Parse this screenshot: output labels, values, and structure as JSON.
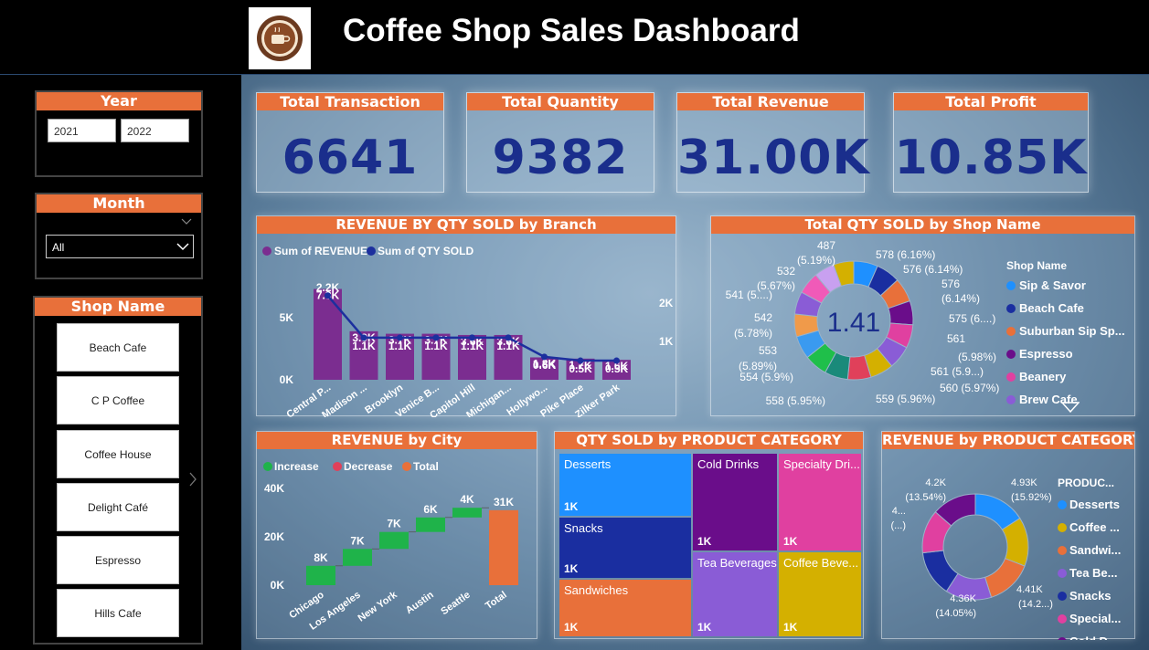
{
  "header": {
    "title": "Coffee Shop Sales Dashboard",
    "colors": {
      "accent": "#e8703a",
      "kpi_value": "#1a2e8c"
    }
  },
  "slicers": {
    "year": {
      "title": "Year",
      "options": [
        "2021",
        "2022"
      ]
    },
    "month": {
      "title": "Month",
      "selected": "All"
    },
    "shop": {
      "title": "Shop Name",
      "items": [
        "Beach Cafe",
        "C P Coffee",
        "Coffee House",
        "Delight Café",
        "Espresso",
        "Hills Cafe"
      ]
    }
  },
  "kpis": [
    {
      "label": "Total Transaction",
      "value": "6641"
    },
    {
      "label": "Total Quantity",
      "value": "9382"
    },
    {
      "label": "Total Revenue",
      "value": "31.00K"
    },
    {
      "label": "Total Profit",
      "value": "10.85K"
    }
  ],
  "chart_data": [
    {
      "type": "bar",
      "title": "REVENUE BY QTY SOLD by Branch",
      "categories": [
        "Central P...",
        "Madison ...",
        "Brooklyn",
        "Venice B...",
        "Capitol Hill",
        "Michigan...",
        "Hollywo...",
        "Pike Place",
        "Zilker Park"
      ],
      "series": [
        {
          "name": "Sum of REVENUE",
          "values": [
            7300,
            3900,
            3700,
            3700,
            3600,
            3600,
            1800,
            1700,
            1600
          ],
          "labels": [
            "7.3K",
            "3.9K",
            "3.7K",
            "3.7K",
            "3.6K",
            "3.6K",
            "1.8K",
            "1.7K",
            "1.6K"
          ],
          "color": "#7b2d90"
        },
        {
          "name": "Sum of QTY SOLD",
          "type": "line",
          "values": [
            2200,
            1100,
            1100,
            1100,
            1100,
            1100,
            600,
            500,
            500
          ],
          "labels": [
            "2.2K",
            "1.1K",
            "1.1K",
            "1.1K",
            "1.1K",
            "1.1K",
            "0.6K",
            "0.5K",
            "0.5K"
          ],
          "color": "#1c2f9e"
        }
      ],
      "y_ticks": [
        "5K",
        "0K"
      ],
      "y2_ticks": [
        "2K",
        "1K"
      ],
      "ylim": [
        0,
        8000
      ],
      "y2lim": [
        0,
        2600
      ]
    },
    {
      "type": "pie",
      "title": "Total QTY SOLD by Shop Name",
      "center_label": "1.41",
      "legend_title": "Shop Name",
      "legend": [
        {
          "name": "Sip & Savor",
          "color": "#1e90ff"
        },
        {
          "name": "Beach Cafe",
          "color": "#1a2ea0"
        },
        {
          "name": "Suburban Sip Sp...",
          "color": "#e8703a"
        },
        {
          "name": "Espresso",
          "color": "#6a0d8a"
        },
        {
          "name": "Beanery",
          "color": "#e040a0"
        },
        {
          "name": "Brew Cafe",
          "color": "#8a5cd6"
        }
      ],
      "slices": [
        {
          "value": 578,
          "color": "#1e90ff"
        },
        {
          "value": 576,
          "color": "#1a2ea0"
        },
        {
          "value": 576,
          "color": "#e8703a"
        },
        {
          "value": 575,
          "color": "#6a0d8a"
        },
        {
          "value": 561,
          "color": "#e040a0"
        },
        {
          "value": 561,
          "color": "#8a5cd6"
        },
        {
          "value": 560,
          "color": "#d4b000"
        },
        {
          "value": 559,
          "color": "#e0405a"
        },
        {
          "value": 558,
          "color": "#1a8a7a"
        },
        {
          "value": 554,
          "color": "#1fbf4a"
        },
        {
          "value": 553,
          "color": "#3a9af0"
        },
        {
          "value": 542,
          "color": "#f09a4a"
        },
        {
          "value": 541,
          "color": "#8a5cd6"
        },
        {
          "value": 532,
          "color": "#f05ab8"
        },
        {
          "value": 487,
          "color": "#c8a0f0"
        },
        {
          "value": 487,
          "color": "#d4b000"
        }
      ],
      "labels": [
        "578 (6.16%)",
        "576 (6.14%)",
        "576",
        "(6.14%)",
        "575 (6....)",
        "561",
        "(5.98%)",
        "561 (5.9...)",
        "560 (5.97%)",
        "559 (5.96%)",
        "558 (5.95%)",
        "554 (5.9%)",
        "553",
        "(5.89%)",
        "542",
        "(5.78%)",
        "541 (5....)",
        "532",
        "(5.67%)",
        "487",
        "(5.19%)"
      ]
    },
    {
      "type": "bar",
      "subtype": "waterfall",
      "title": "REVENUE by City",
      "legend": [
        {
          "name": "Increase",
          "color": "#1fb34a"
        },
        {
          "name": "Decrease",
          "color": "#e0405a"
        },
        {
          "name": "Total",
          "color": "#e8703a"
        }
      ],
      "categories": [
        "Chicago",
        "Los Angeles",
        "New York",
        "Austin",
        "Seattle",
        "Total"
      ],
      "values": [
        8000,
        7000,
        7000,
        6000,
        4000,
        31000
      ],
      "labels": [
        "8K",
        "7K",
        "7K",
        "6K",
        "4K",
        "31K"
      ],
      "y_ticks": [
        "40K",
        "20K",
        "0K"
      ],
      "ylim": [
        0,
        40000
      ]
    },
    {
      "type": "table",
      "subtype": "treemap",
      "title": "QTY SOLD by PRODUCT CATEGORY",
      "cells": [
        {
          "name": "Desserts",
          "value": "1K",
          "color": "#1e90ff"
        },
        {
          "name": "Snacks",
          "value": "1K",
          "color": "#1a2ea0"
        },
        {
          "name": "Sandwiches",
          "value": "1K",
          "color": "#e8703a"
        },
        {
          "name": "Cold Drinks",
          "value": "1K",
          "color": "#6a0d8a"
        },
        {
          "name": "Tea Beverages",
          "value": "1K",
          "color": "#8a5cd6"
        },
        {
          "name": "Specialty Dri...",
          "value": "1K",
          "color": "#e040a0"
        },
        {
          "name": "Coffee Beve...",
          "value": "1K",
          "color": "#d4b000"
        }
      ]
    },
    {
      "type": "pie",
      "title": "REVENUE by PRODUCT CATEGORY",
      "legend_title": "PRODUC...",
      "legend": [
        {
          "name": "Desserts",
          "color": "#1e90ff"
        },
        {
          "name": "Coffee ...",
          "color": "#d4b000"
        },
        {
          "name": "Sandwi...",
          "color": "#e8703a"
        },
        {
          "name": "Tea Be...",
          "color": "#8a5cd6"
        },
        {
          "name": "Snacks",
          "color": "#1a2ea0"
        },
        {
          "name": "Special...",
          "color": "#e040a0"
        },
        {
          "name": "Cold D...",
          "color": "#6a0d8a"
        }
      ],
      "slices": [
        {
          "value": 15.92,
          "color": "#1e90ff"
        },
        {
          "value": 15.0,
          "color": "#d4b000"
        },
        {
          "value": 14.2,
          "color": "#e8703a"
        },
        {
          "value": 14.05,
          "color": "#8a5cd6"
        },
        {
          "value": 14.0,
          "color": "#1a2ea0"
        },
        {
          "value": 13.3,
          "color": "#e040a0"
        },
        {
          "value": 13.54,
          "color": "#6a0d8a"
        }
      ],
      "labels": [
        "4.93K",
        "(15.92%)",
        "4.41K",
        "(14.2...)",
        "4.36K",
        "(14.05%)",
        "4...",
        "(...)",
        "4.2K",
        "(13.54%)"
      ]
    }
  ]
}
